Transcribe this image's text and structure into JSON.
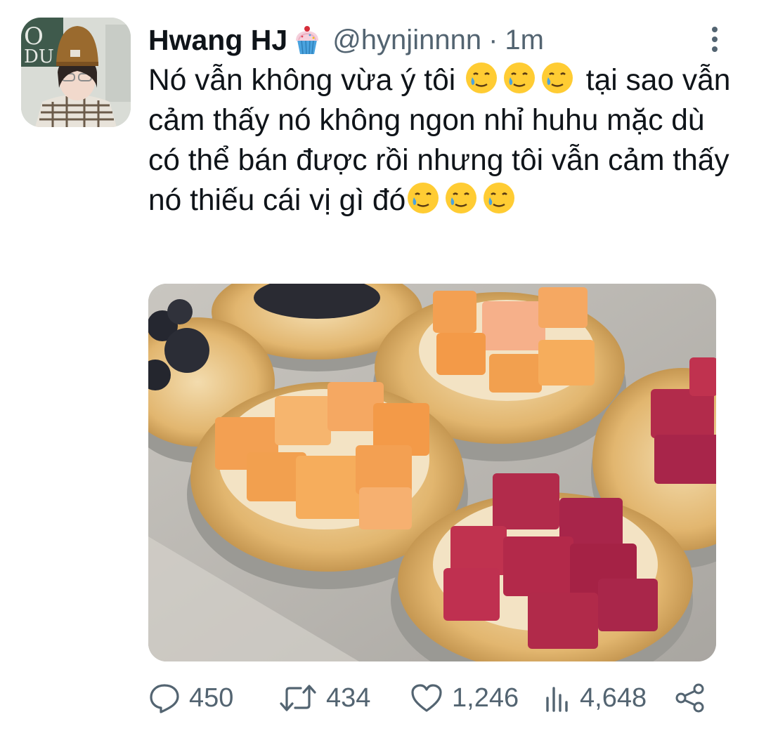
{
  "tweet": {
    "display_name": "Hwang HJ",
    "name_emoji_icon": "cupcake-icon",
    "handle": "@hynjinnnn",
    "separator": "·",
    "time": "1m",
    "text_lines": [
      "Nó vẫn không vừa ý tôi",
      "tại sao vẫn cảm thấy nó không ngon nhỉ huhu mặc dù có thể bán được rồi nhưng tôi vẫn cảm thấy nó thiếu cái vị gì đó"
    ],
    "emoji_icon": "smiling-face-with-tear-icon",
    "media_description_icon": "photo-fruit-tarts"
  },
  "actions": {
    "reply_count": "450",
    "retweet_count": "434",
    "like_count": "1,246",
    "view_count": "4,648"
  },
  "colors": {
    "text": "#0f1419",
    "secondary": "#536471"
  }
}
